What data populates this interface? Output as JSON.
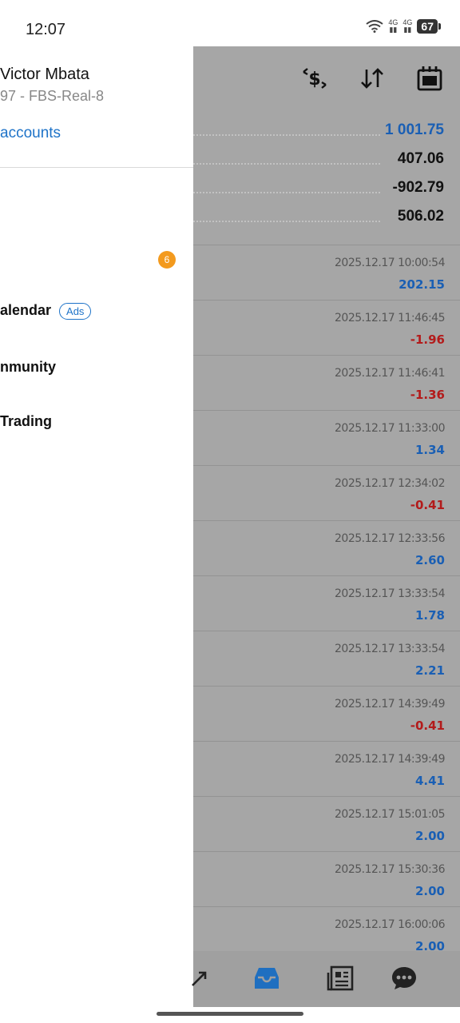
{
  "status_bar": {
    "time": "12:07",
    "network1": "4G",
    "network2": "4G",
    "battery": "67"
  },
  "drawer": {
    "user_name": "Victor Mbata",
    "account_line": "97 - FBS-Real-8",
    "accounts_link": "accounts",
    "badge_count": "6",
    "items": [
      {
        "label": "alendar",
        "chip": "Ads"
      },
      {
        "label": "nmunity"
      },
      {
        "label": "Trading"
      }
    ]
  },
  "panel": {
    "balances": [
      {
        "value": "1 001.75",
        "color": "#1a5fb4"
      },
      {
        "value": "407.06",
        "color": "#111111"
      },
      {
        "value": "-902.79",
        "color": "#111111"
      },
      {
        "value": "506.02",
        "color": "#111111"
      }
    ],
    "trades": [
      {
        "date": "2025.12.17 10:00:54",
        "value": "202.15",
        "sign": "pos"
      },
      {
        "date": "2025.12.17 11:46:45",
        "value": "-1.96",
        "sign": "neg"
      },
      {
        "date": "2025.12.17 11:46:41",
        "value": "-1.36",
        "sign": "neg"
      },
      {
        "date": "2025.12.17 11:33:00",
        "value": "1.34",
        "sign": "pos"
      },
      {
        "date": "2025.12.17 12:34:02",
        "value": "-0.41",
        "sign": "neg"
      },
      {
        "date": "2025.12.17 12:33:56",
        "value": "2.60",
        "sign": "pos"
      },
      {
        "date": "2025.12.17 13:33:54",
        "value": "1.78",
        "sign": "pos"
      },
      {
        "date": "2025.12.17 13:33:54",
        "value": "2.21",
        "sign": "pos"
      },
      {
        "date": "2025.12.17 14:39:49",
        "value": "-0.41",
        "sign": "neg"
      },
      {
        "date": "2025.12.17 14:39:49",
        "value": "4.41",
        "sign": "pos"
      },
      {
        "date": "2025.12.17 15:01:05",
        "value": "2.00",
        "sign": "pos"
      },
      {
        "date": "2025.12.17 15:30:36",
        "value": "2.00",
        "sign": "pos"
      },
      {
        "date": "2025.12.17 16:00:06",
        "value": "2.00",
        "sign": "pos"
      }
    ]
  },
  "icons": {
    "toolbar": [
      "currency-exchange-icon",
      "sort-icon",
      "calendar-icon"
    ],
    "bottom_nav": [
      "chart-icon",
      "history-inbox-icon",
      "news-icon",
      "chat-icon"
    ]
  }
}
